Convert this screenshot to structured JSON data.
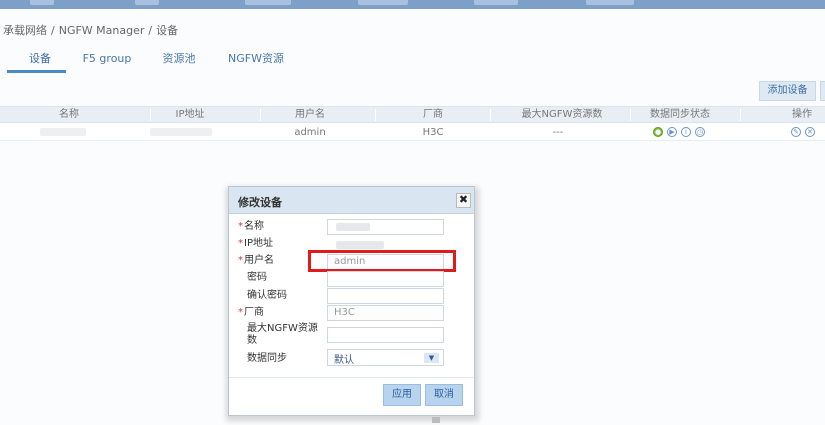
{
  "breadcrumb": {
    "items": [
      "承载网络",
      "NGFW Manager",
      "设备"
    ],
    "separator": "/"
  },
  "tabs": [
    {
      "label": "设备",
      "active": true
    },
    {
      "label": "F5 group",
      "active": false
    },
    {
      "label": "资源池",
      "active": false
    },
    {
      "label": "NGFW资源",
      "active": false
    }
  ],
  "toolbar": {
    "add_device_label": "添加设备"
  },
  "table": {
    "columns": [
      "名称",
      "IP地址",
      "用户名",
      "厂商",
      "最大NGFW资源数",
      "数据同步状态",
      "操作"
    ],
    "rows": [
      {
        "name": "",
        "ip": "",
        "username": "admin",
        "vendor": "H3C",
        "max_ngfw": "---"
      }
    ]
  },
  "modal": {
    "title": "修改设备",
    "close_symbol": "✖",
    "required_mark": "*",
    "fields": {
      "name_label": "名称",
      "ip_label": "IP地址",
      "username_label": "用户名",
      "username_value": "admin",
      "password_label": "密码",
      "confirm_password_label": "确认密码",
      "vendor_label": "厂商",
      "vendor_value": "H3C",
      "max_ngfw_label_line1": "最大NGFW资源",
      "max_ngfw_label_line2": "数",
      "sync_label": "数据同步",
      "sync_value": "默认"
    },
    "apply_label": "应用",
    "cancel_label": "取消"
  },
  "colors": {
    "accent": "#3b6ea5",
    "highlight": "#e01b1b",
    "required": "#d23b3b",
    "status_ok": "#7dbd3c"
  },
  "icons": {
    "status": [
      "status-ok-icon",
      "play-icon",
      "info-icon",
      "clock-icon"
    ],
    "operations": [
      "edit-icon",
      "delete-icon"
    ]
  }
}
